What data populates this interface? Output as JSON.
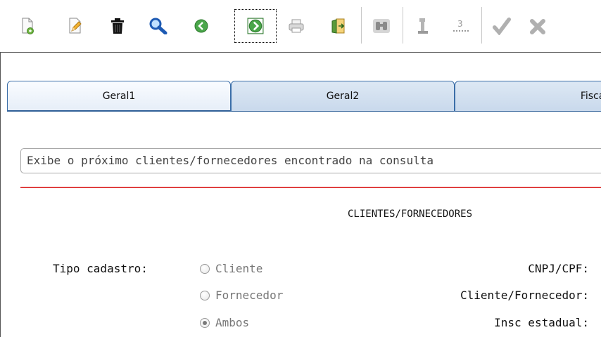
{
  "toolbar": {
    "icons": [
      "new-document",
      "edit-pencil",
      "delete-trash",
      "search",
      "previous",
      "next",
      "print",
      "exit-door",
      "binoculars",
      "key-1",
      "key-2",
      "confirm-check",
      "cancel-x"
    ]
  },
  "tabs": [
    {
      "label": "Geral1",
      "active": true
    },
    {
      "label": "Geral2",
      "active": false
    },
    {
      "label": "Fiscal",
      "active": false
    }
  ],
  "hint_text": "Exibe o próximo clientes/fornecedores encontrado na consulta",
  "form": {
    "title": "CLIENTES/FORNECEDORES",
    "tipo_label": "Tipo cadastro:",
    "options": [
      {
        "label": "Cliente",
        "checked": false
      },
      {
        "label": "Fornecedor",
        "checked": false
      },
      {
        "label": "Ambos",
        "checked": true
      }
    ],
    "right_labels": [
      "CNPJ/CPF:",
      "Cliente/Fornecedor:",
      "Insc estadual:"
    ]
  },
  "colors": {
    "tab_border": "#3b6ea8",
    "divider": "#e04040"
  }
}
